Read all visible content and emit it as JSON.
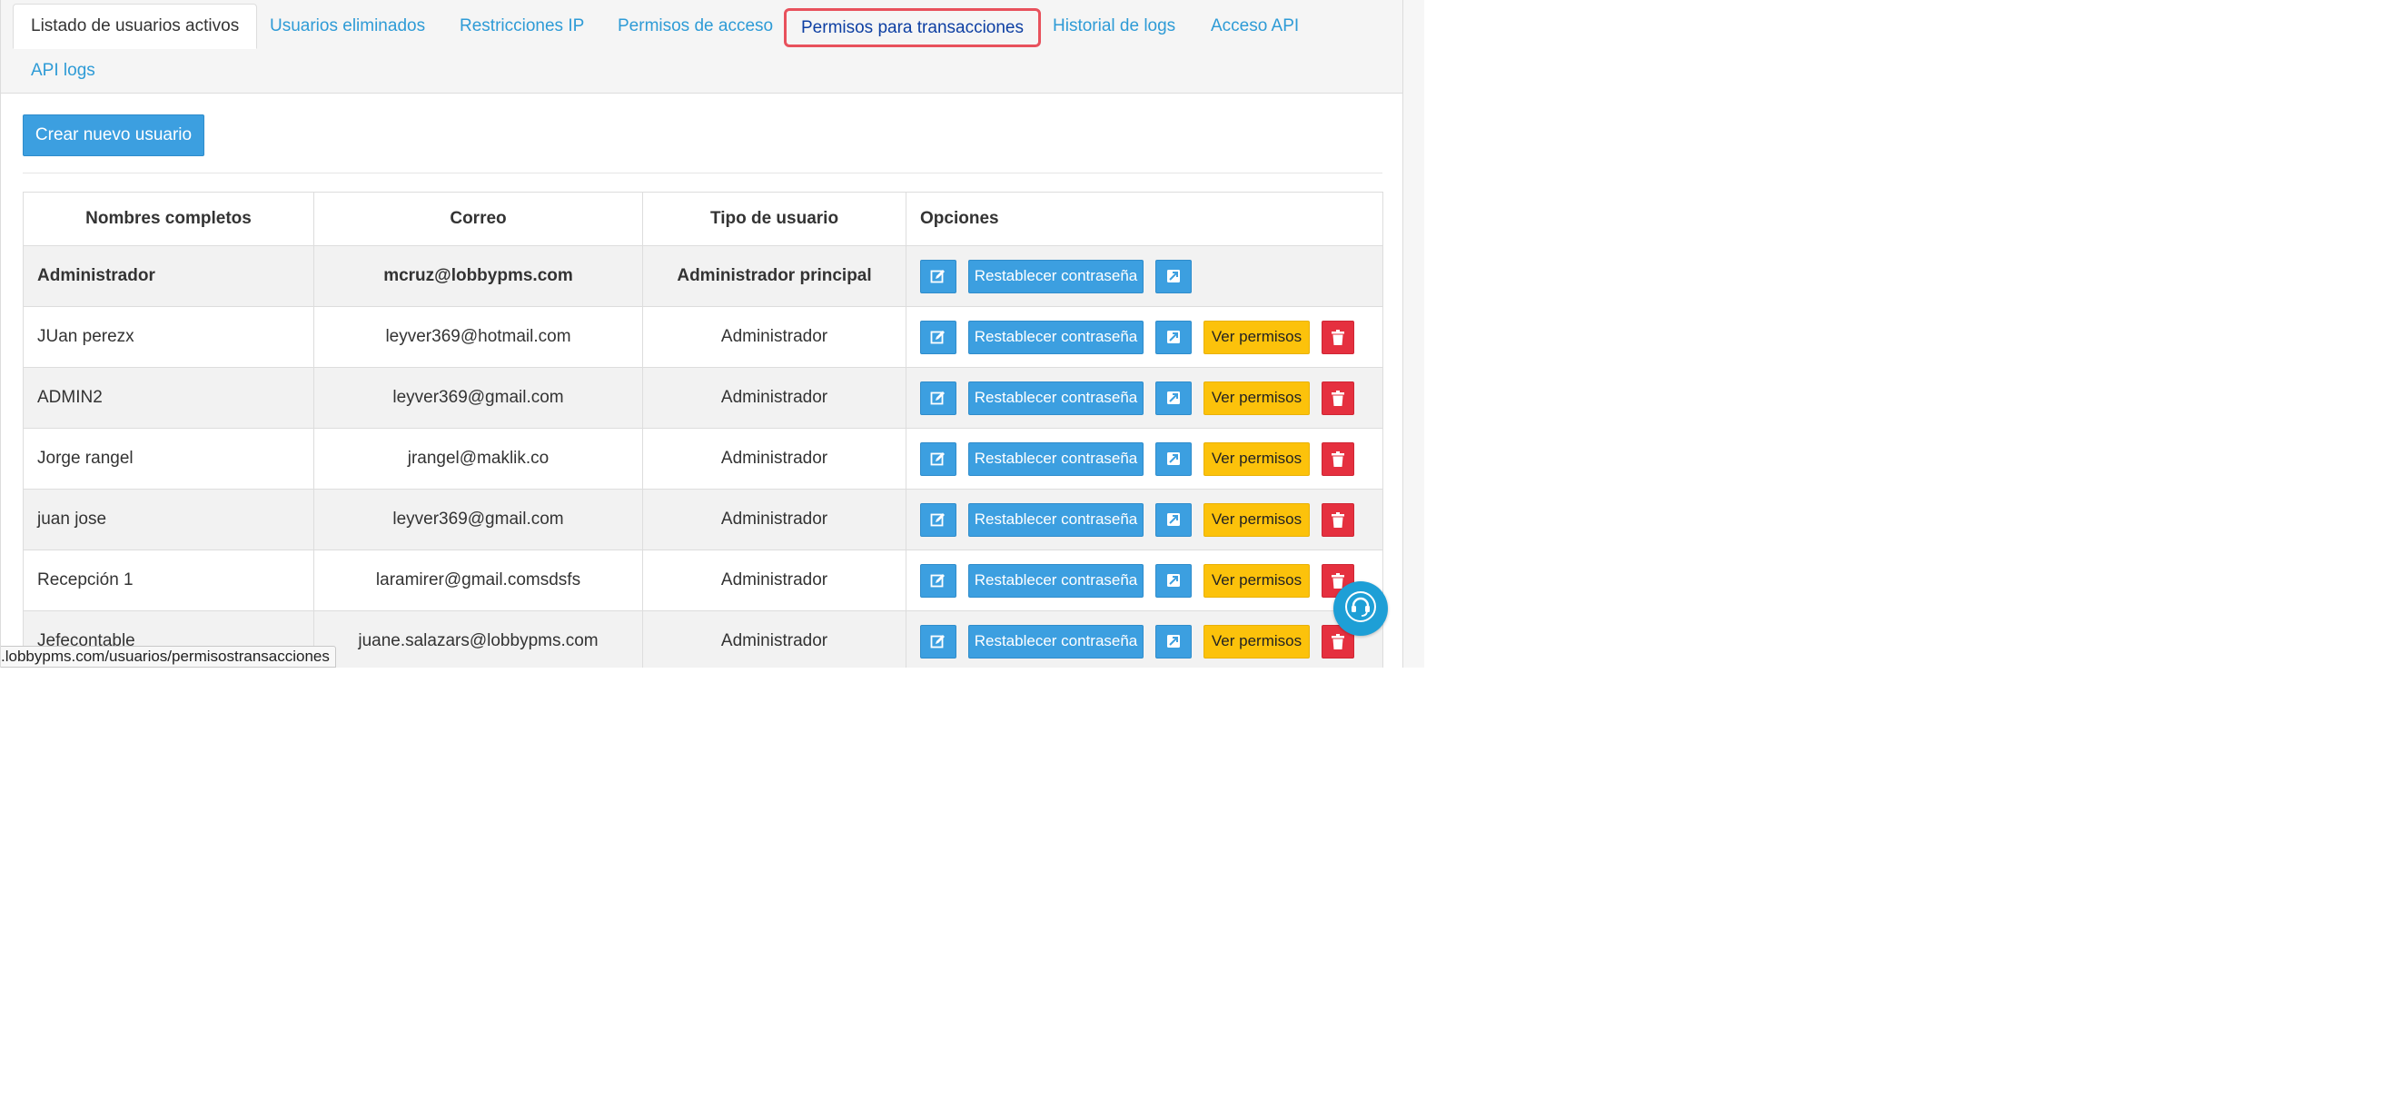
{
  "tabs": [
    {
      "label": "Listado de usuarios activos",
      "state": "active"
    },
    {
      "label": "Usuarios eliminados",
      "state": "normal"
    },
    {
      "label": "Restricciones IP",
      "state": "normal"
    },
    {
      "label": "Permisos de acceso",
      "state": "normal"
    },
    {
      "label": "Permisos para transacciones",
      "state": "highlighted"
    },
    {
      "label": "Historial de logs",
      "state": "normal"
    },
    {
      "label": "Acceso API",
      "state": "normal"
    },
    {
      "label": "API logs",
      "state": "normal"
    }
  ],
  "toolbar": {
    "create_label": "Crear nuevo usuario"
  },
  "table": {
    "headers": {
      "name": "Nombres completos",
      "email": "Correo",
      "type": "Tipo de usuario",
      "options": "Opciones"
    },
    "rows": [
      {
        "name": "Administrador",
        "email": "mcruz@lobbypms.com",
        "type": "Administrador principal"
      },
      {
        "name": "JUan perezx",
        "email": "leyver369@hotmail.com",
        "type": "Administrador"
      },
      {
        "name": "ADMIN2",
        "email": "leyver369@gmail.com",
        "type": "Administrador"
      },
      {
        "name": "Jorge rangel",
        "email": "jrangel@maklik.co",
        "type": "Administrador"
      },
      {
        "name": "juan jose",
        "email": "leyver369@gmail.com",
        "type": "Administrador"
      },
      {
        "name": "Recepción 1",
        "email": "laramirer@gmail.comsdsfs",
        "type": "Administrador"
      },
      {
        "name": "Jefecontable",
        "email": "juane.salazars@lobbypms.com",
        "type": "Administrador"
      }
    ],
    "actions": {
      "reset_label": "Restablecer contraseña",
      "permissions_label": "Ver permisos"
    }
  },
  "status_bar": {
    "url": ".lobbypms.com/usuarios/permisostransacciones"
  },
  "icons": {
    "edit": "edit-icon",
    "image": "image-icon",
    "delete": "trash-icon",
    "support": "headset-icon"
  },
  "colors": {
    "primary": "#3c9fe0",
    "warning": "#fcc20b",
    "danger": "#e5303f",
    "highlight": "#e8515c",
    "link": "#2e9bd6"
  }
}
